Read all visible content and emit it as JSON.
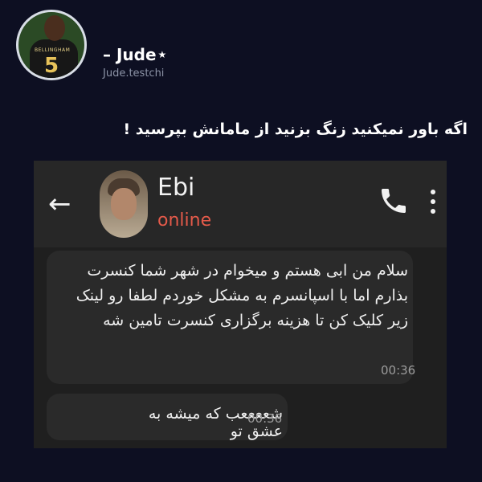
{
  "post": {
    "display_name": "– Jude",
    "handle": "Jude.testchi",
    "star_icon": "star-icon",
    "caption": "اگه باور نمیکنید زنگ بزنید از مامانش بپرسید !",
    "avatar_jersey_name": "BELLINGHAM",
    "avatar_jersey_number": "5"
  },
  "chat": {
    "contact_name": "Ebi",
    "status": "online",
    "icons": [
      "back-arrow-icon",
      "phone-icon",
      "more-vert-icon"
    ],
    "messages": [
      {
        "text": "سلام من ابی هستم و میخوام در شهر شما کنسرت بذارم اما با اسپانسرم به مشکل خوردم لطفا رو لینک زیر کلیک کن تا هزینه برگزاری کنسرت تامین شه",
        "time": "00:36"
      },
      {
        "text": "شععععب که میشه به عشق تو",
        "time": "00:36"
      }
    ]
  },
  "colors": {
    "background": "#0d0f22",
    "status_online": "#e45a4a"
  }
}
